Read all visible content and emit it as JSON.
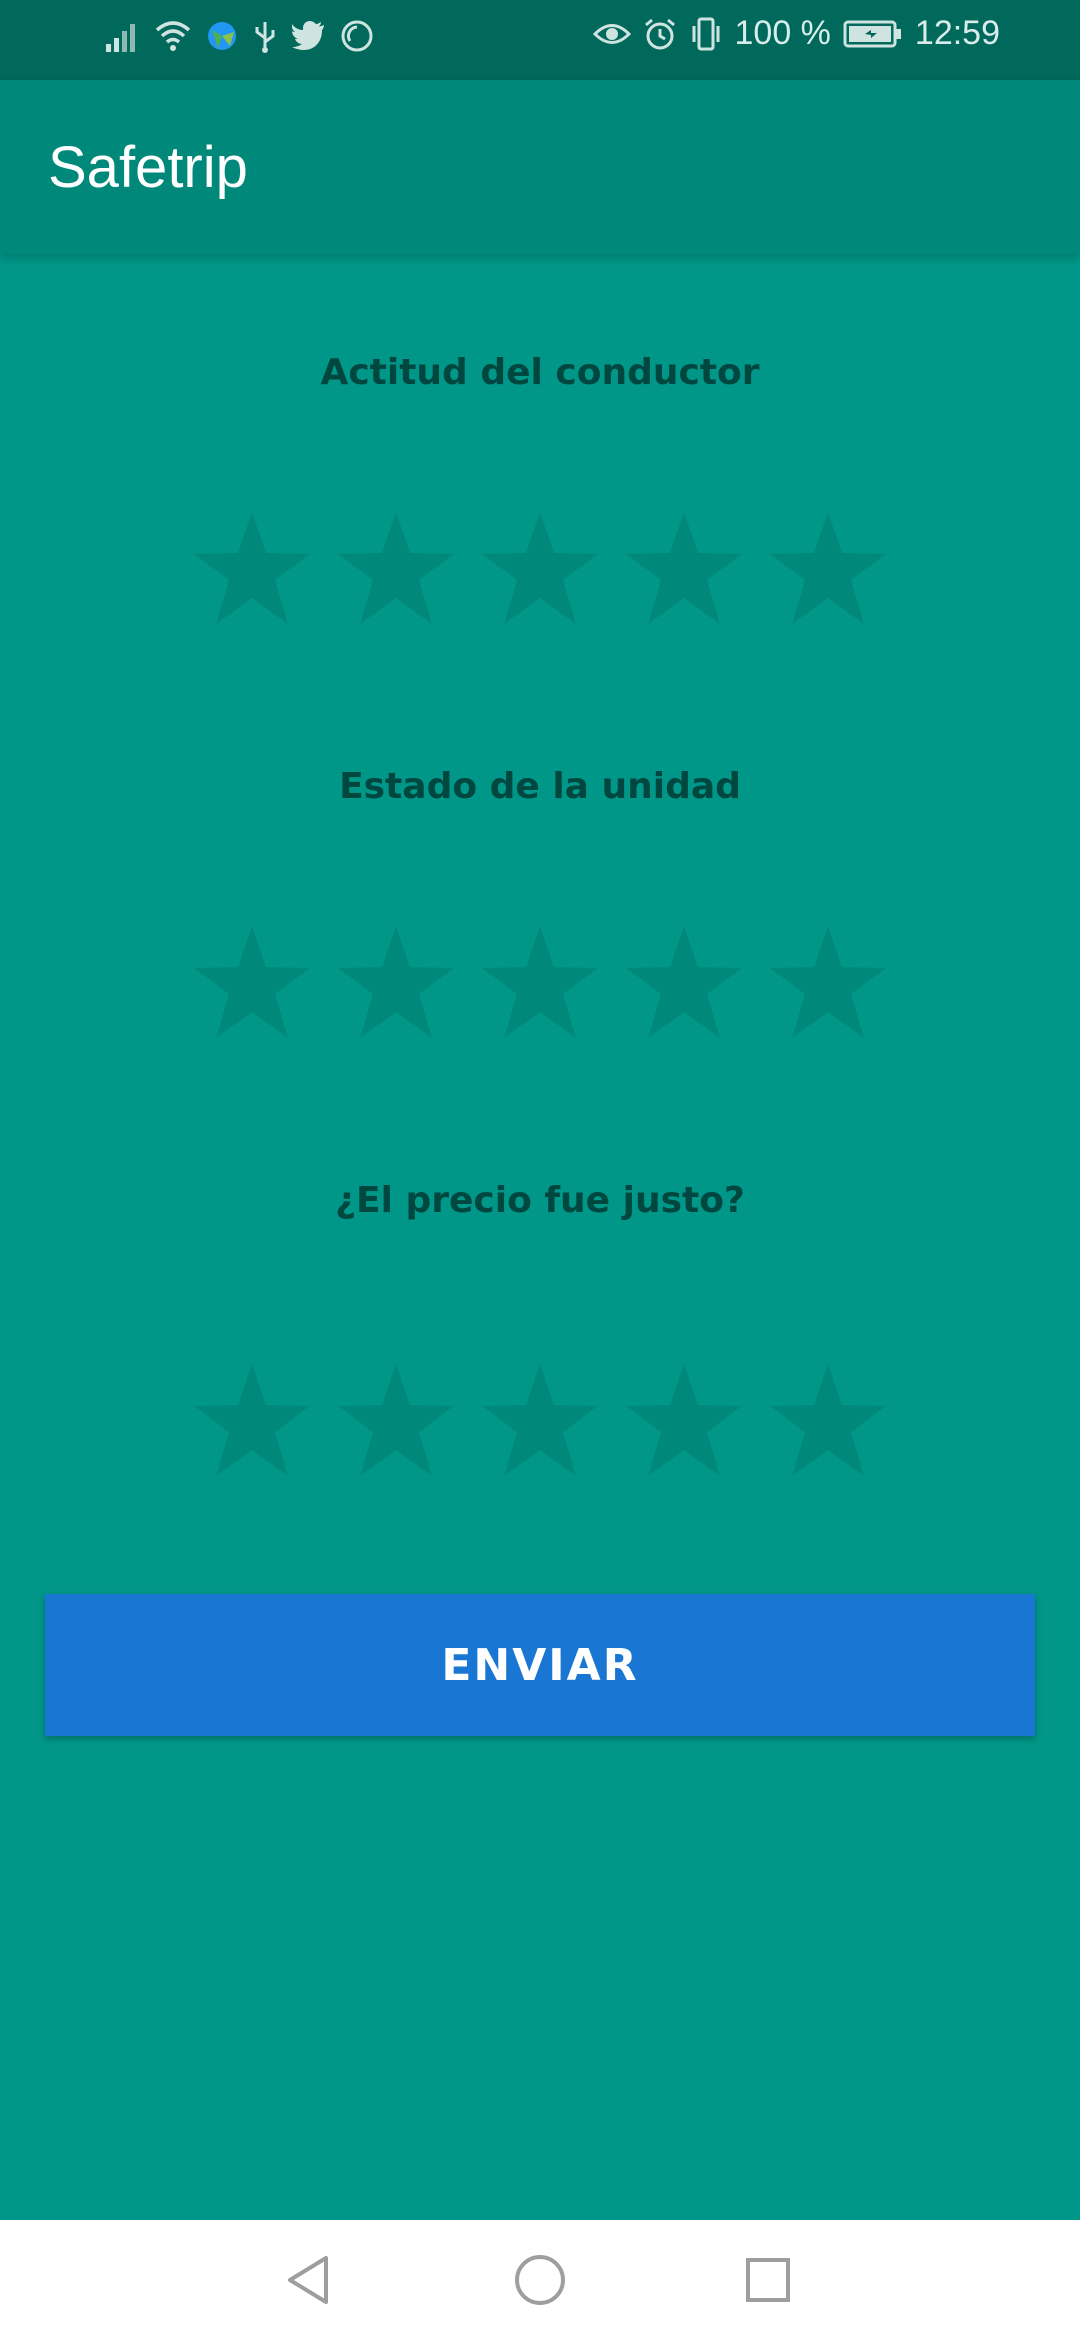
{
  "status_bar": {
    "battery_text": "100 %",
    "time": "12:59",
    "icons": [
      "signal-icon",
      "wifi-icon",
      "browser-icon",
      "usb-icon",
      "twitter-icon",
      "sync-icon",
      "eye-icon",
      "alarm-icon",
      "vibrate-icon",
      "battery-icon"
    ]
  },
  "app_bar": {
    "title": "Safetrip"
  },
  "ratings": [
    {
      "label": "Actitud del conductor",
      "stars": 5,
      "value": 0
    },
    {
      "label": "Estado de la unidad",
      "stars": 5,
      "value": 0
    },
    {
      "label": "¿El precio fue justo?",
      "stars": 5,
      "value": 0
    }
  ],
  "submit_button": {
    "label": "ENVIAR"
  },
  "colors": {
    "status_bar": "#00695c",
    "app_bar": "#00897b",
    "background": "#009688",
    "star_empty": "#00897b",
    "button": "#1976d2",
    "label_text": "#00473f"
  },
  "nav_bar": {
    "icons": [
      "back-icon",
      "home-icon",
      "recents-icon"
    ]
  }
}
